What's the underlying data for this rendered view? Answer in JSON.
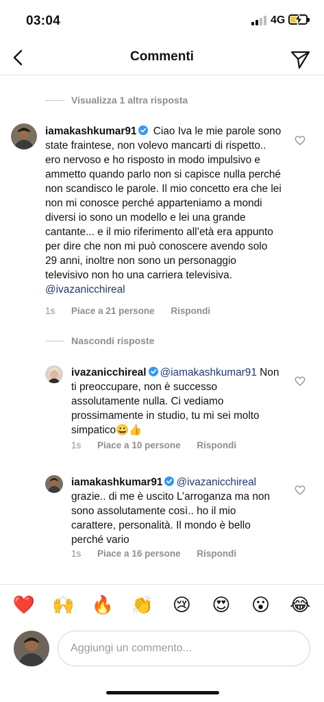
{
  "status_bar": {
    "time": "03:04",
    "network": "4G"
  },
  "header": {
    "title": "Commenti",
    "back_icon": "chevron-left-icon",
    "send_icon": "paper-plane-icon"
  },
  "thread": {
    "view_more_label": "Visualizza 1 altra risposta",
    "hide_replies_label": "Nascondi risposte"
  },
  "comments": [
    {
      "username": "iamakashkumar91",
      "verified": true,
      "text": "Ciao Iva le mie parole sono state fraintese, non volevo mancarti di rispetto.. ero nervoso e ho risposto in modo impulsivo e ammetto quando parlo non si capisce nulla perché non scandisco le parole. Il mio concetto era che lei non mi conosce perché apparteniamo a mondi diversi io sono un modello e lei una grande cantante... e il mio riferimento all’età era appunto per dire che non mi può conoscere avendo solo 29 anni, inoltre non sono un personaggio televisivo non ho una carriera televisiva.",
      "mention": "@ivazanicchireal",
      "time": "1s",
      "likes": "Piace a 21 persone",
      "reply_label": "Rispondi"
    },
    {
      "username": "ivazanicchireal",
      "verified": true,
      "mention": "@iamakashkumar91",
      "text": "Non ti preoccupare, non è successo assolutamente nulla. Ci vediamo prossimamente in studio, tu mi sei molto simpatico😀👍",
      "time": "1s",
      "likes": "Piace a 10 persone",
      "reply_label": "Rispondi"
    },
    {
      "username": "iamakashkumar91",
      "verified": true,
      "mention": "@ivazanicchireal",
      "text": "grazie.. di me è uscito L’arroganza ma non sono assolutamente così.. ho il mio carattere, personalità. Il mondo è bello perché vario",
      "time": "1s",
      "likes": "Piace a 16 persone",
      "reply_label": "Rispondi"
    }
  ],
  "emoji_bar": [
    "❤️",
    "🙌",
    "🔥",
    "👏",
    "😢",
    "😍",
    "😮",
    "😂"
  ],
  "composer": {
    "placeholder": "Aggiungi un commento..."
  },
  "colors": {
    "verified": "#3897f0",
    "mention": "#1e3a6e",
    "muted": "#8e8e8e",
    "heart_red": "#ed4956"
  }
}
